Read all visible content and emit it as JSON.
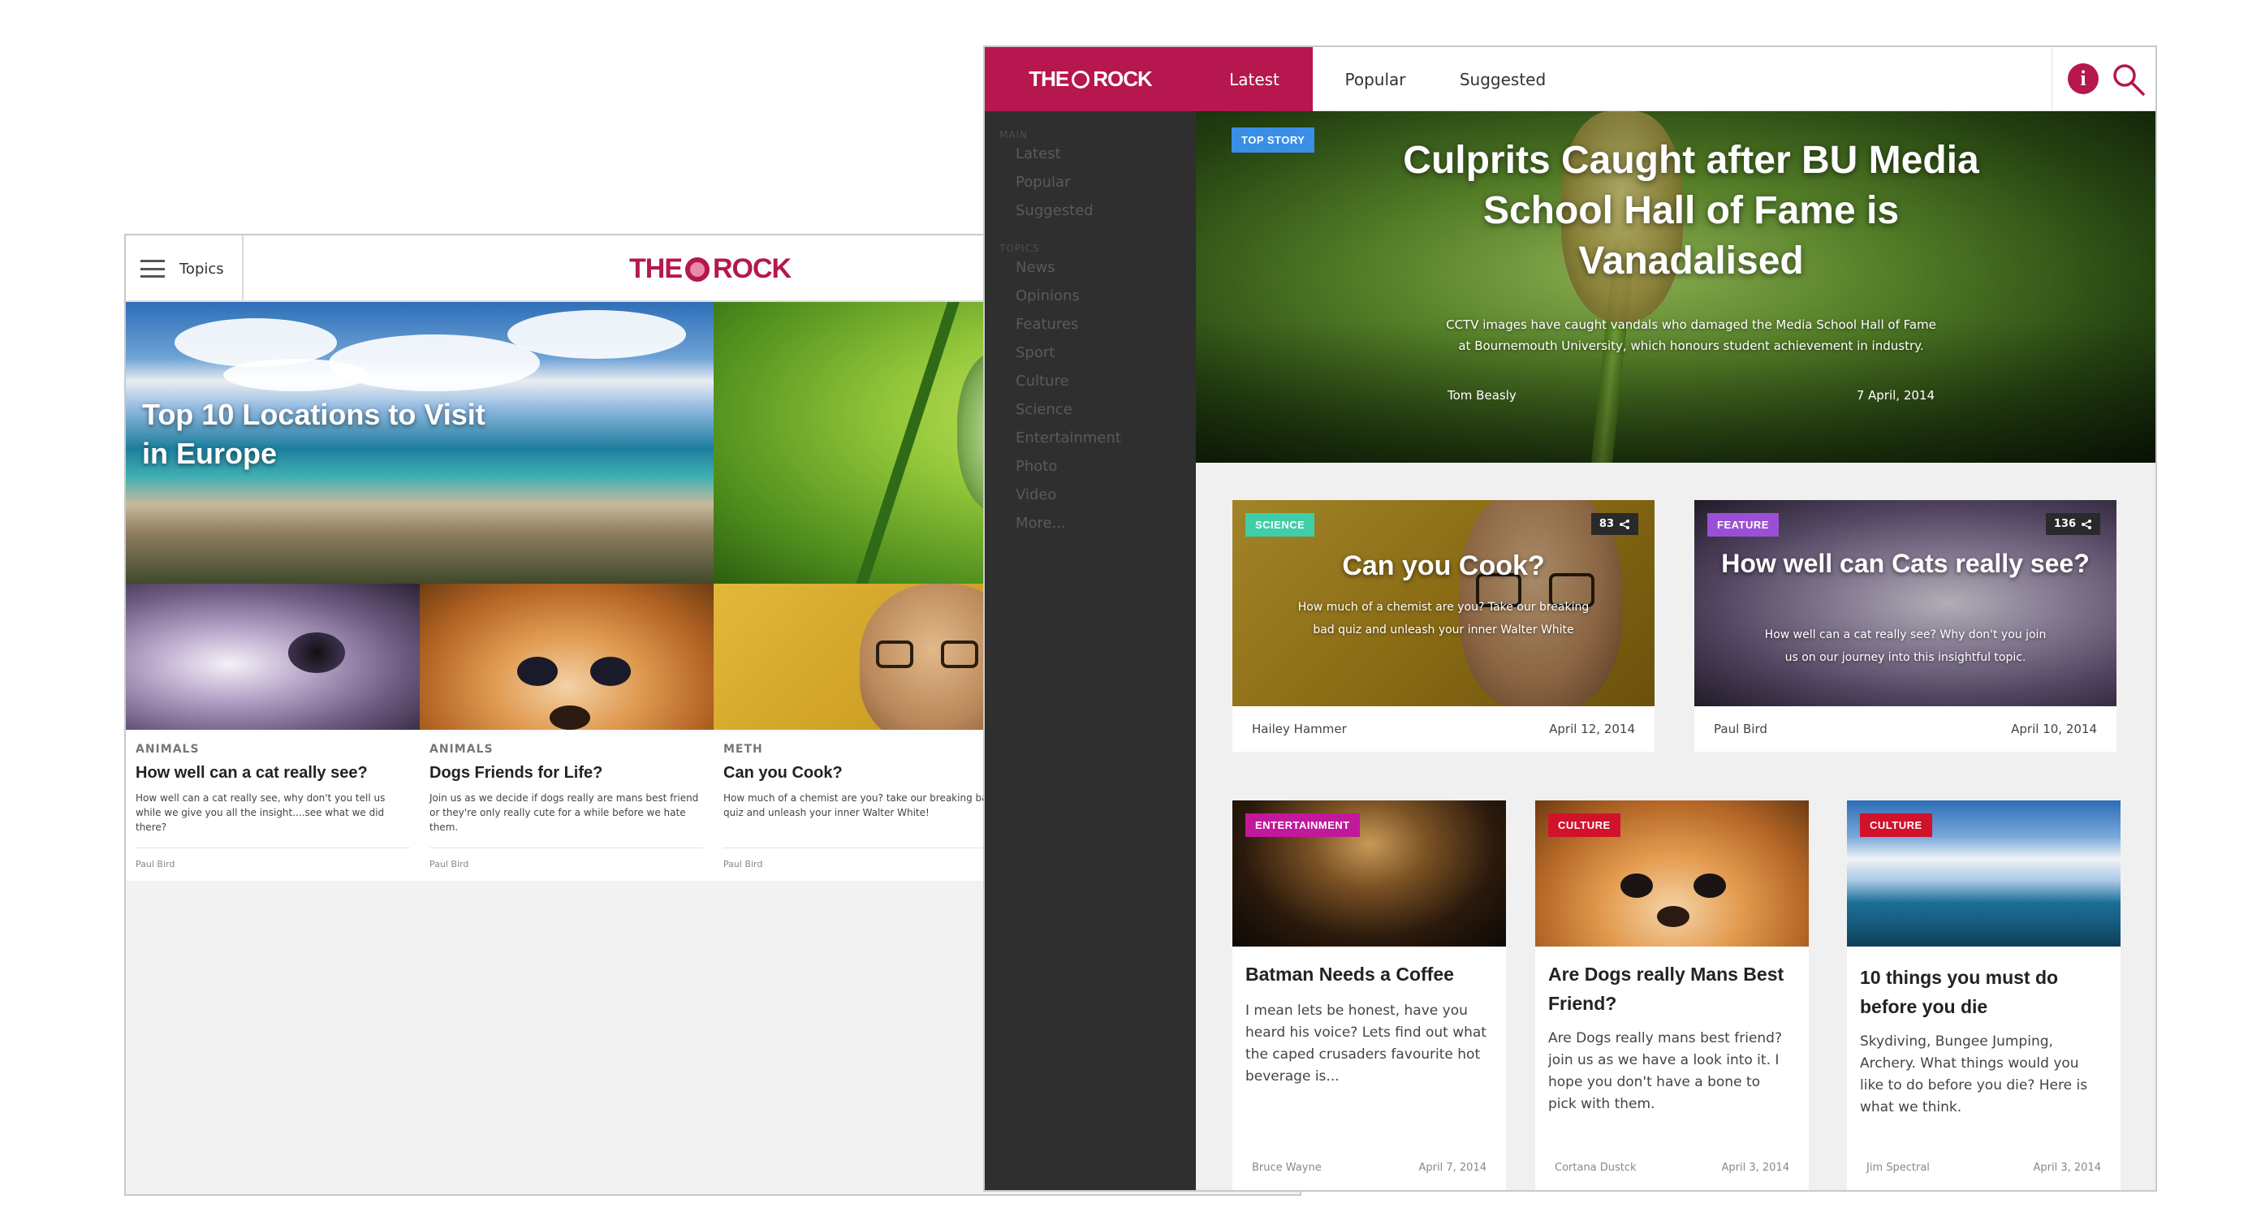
{
  "back": {
    "topics_label": "Topics",
    "logo_left": "THE",
    "logo_right": "ROCK",
    "hero_title": "Top 10 Locations to Visit in Europe",
    "cards": [
      {
        "category": "ANIMALS",
        "title": "How well can a cat really see?",
        "desc": "How well can a cat really see, why don't you tell us while we give you all the insight....see what we did there?",
        "author": "Paul Bird"
      },
      {
        "category": "ANIMALS",
        "title": "Dogs Friends for Life?",
        "desc": "Join us as we decide if dogs really are mans best friend or they're only really cute for a while before we hate them.",
        "author": "Paul Bird"
      },
      {
        "category": "METH",
        "title": "Can you Cook?",
        "desc": "How much of a chemist are you? take our breaking bad quiz and unleash your inner Walter White!",
        "author": "Paul Bird"
      }
    ]
  },
  "front": {
    "logo_left": "THE",
    "logo_right": "ROCK",
    "nav": [
      "Latest",
      "Popular",
      "Suggested"
    ],
    "sidebar": {
      "main_heading": "MAIN",
      "main_items": [
        "Latest",
        "Popular",
        "Suggested"
      ],
      "topics_heading": "TOPICS",
      "topic_items": [
        "News",
        "Opinions",
        "Features",
        "Sport",
        "Culture",
        "Science",
        "Entertainment",
        "Photo",
        "Video",
        "More..."
      ]
    },
    "hero": {
      "badge": "TOP STORY",
      "title": "Culprits Caught after BU Media School Hall of Fame is Vanadalised",
      "desc": "CCTV images have caught vandals who damaged the Media School Hall of Fame at Bournemouth University, which honours student achievement in industry.",
      "author": "Tom Beasly",
      "date": "7 April, 2014"
    },
    "featured": [
      {
        "badge": "SCIENCE",
        "badge_color": "#3ecfa8",
        "shares": "83",
        "title": "Can you Cook?",
        "desc": "How much of a chemist are you? Take our breaking bad quiz and unleash your inner Walter White",
        "author": "Hailey Hammer",
        "date": "April 12, 2014"
      },
      {
        "badge": "FEATURE",
        "badge_color": "#9b4fd6",
        "shares": "136",
        "title": "How well can Cats really see?",
        "desc": "How well can a cat really see? Why don't you join us on our journey into this insightful topic.",
        "author": "Paul Bird",
        "date": "April 10, 2014"
      }
    ],
    "articles": [
      {
        "badge": "ENTERTAINMENT",
        "badge_color": "#c2189b",
        "title": "Batman Needs a Coffee",
        "desc": "I mean lets be honest, have you heard his voice? Lets find out what the caped crusaders favourite hot beverage is...",
        "author": "Bruce Wayne",
        "date": "April 7, 2014"
      },
      {
        "badge": "CULTURE",
        "badge_color": "#d0122b",
        "title": "Are Dogs really Mans Best Friend?",
        "desc": "Are Dogs really mans best friend? join us as we have a look into it. I hope you don't have a bone to pick with them.",
        "author": "Cortana Dustck",
        "date": "April 3, 2014"
      },
      {
        "badge": "CULTURE",
        "badge_color": "#d0122b",
        "title": "10 things you must do before you die",
        "desc": "Skydiving, Bungee Jumping, Archery. What things would you like to do before you die? Here is what we think.",
        "author": "Jim Spectral",
        "date": "April 3, 2014"
      }
    ]
  }
}
